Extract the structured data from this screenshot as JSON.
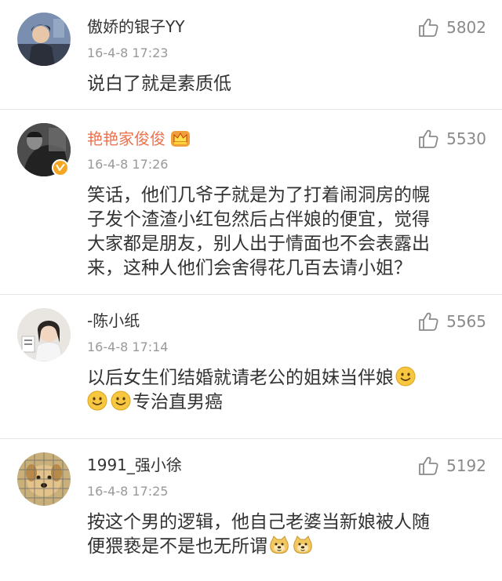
{
  "comments": [
    {
      "username": "傲娇的银子YY",
      "time": "16-4-8 17:23",
      "likes": "5802",
      "lines": [
        "说白了就是素质低"
      ]
    },
    {
      "username": "艳艳家俊俊",
      "time": "16-4-8 17:26",
      "likes": "5530",
      "verified": true,
      "badge_icon": "crown-icon",
      "lines": [
        "笑话，他们几爷子就是为了打着闹洞房的幌",
        "子发个渣渣小红包然后占伴娘的便宜，觉得",
        "大家都是朋友，别人出于情面也不会表露出",
        "来，这种人他们会舍得花几百去请小姐？"
      ]
    },
    {
      "username": "-陈小纸",
      "time": "16-4-8 17:14",
      "likes": "5565",
      "line1": "以后女生们结婚就请老公的姐妹当伴娘",
      "line2": "专治直男癌",
      "emoji_icon": "smile-emoji"
    },
    {
      "username": "1991_强小徐",
      "time": "16-4-8 17:25",
      "likes": "5192",
      "line1": "按这个男的逻辑，他自己老婆当新娘被人随",
      "line2": "便猥亵是不是也无所谓",
      "emoji_icon": "doge-emoji"
    }
  ],
  "colors": {
    "vip_name": "#eb7350",
    "text": "#333333",
    "meta": "#999999",
    "like": "#8a8a8a",
    "emoji": "#f6c73f"
  }
}
